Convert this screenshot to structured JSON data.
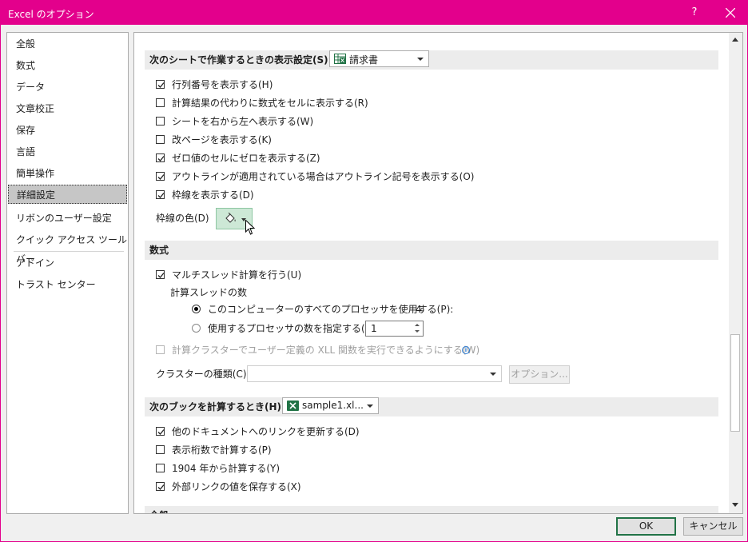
{
  "window": {
    "title": "Excel のオプション",
    "help_label": "?",
    "accent": "#e3008c"
  },
  "sidebar": {
    "items": [
      {
        "label": "全般"
      },
      {
        "label": "数式"
      },
      {
        "label": "データ"
      },
      {
        "label": "文章校正"
      },
      {
        "label": "保存"
      },
      {
        "label": "言語"
      },
      {
        "label": "簡単操作"
      },
      {
        "label": "詳細設定",
        "active": true
      },
      {
        "label": "リボンのユーザー設定"
      },
      {
        "label": "クイック アクセス ツール バー"
      },
      {
        "label": "アドイン"
      },
      {
        "label": "トラスト センター"
      }
    ]
  },
  "sheet_section": {
    "title": "次のシートで作業するときの表示設定(S):",
    "sheet_combo": "請求書",
    "options": [
      {
        "label": "行列番号を表示する(H)",
        "checked": true
      },
      {
        "label": "計算結果の代わりに数式をセルに表示する(R)",
        "checked": false
      },
      {
        "label": "シートを右から左へ表示する(W)",
        "checked": false
      },
      {
        "label": "改ページを表示する(K)",
        "checked": false
      },
      {
        "label": "ゼロ値のセルにゼロを表示する(Z)",
        "checked": true
      },
      {
        "label": "アウトラインが適用されている場合はアウトライン記号を表示する(O)",
        "checked": true
      },
      {
        "label": "枠線を表示する(D)",
        "checked": true
      }
    ],
    "gridline_color_label": "枠線の色(D)",
    "gridline_color_icon": "paint-bucket-icon"
  },
  "formula_section": {
    "title": "数式",
    "multithread_label": "マルチスレッド計算を行う(U)",
    "multithread_checked": true,
    "threads_label": "計算スレッドの数",
    "use_all_label": "このコンピューターのすべてのプロセッサを使用する(P):",
    "processor_count": "4",
    "use_all_selected": true,
    "manual_label": "使用するプロセッサの数を指定する(M):",
    "manual_value": "1",
    "cluster_label": "計算クラスターでユーザー定義の XLL 関数を実行できるようにする(W)",
    "cluster_type_label": "クラスターの種類(C):",
    "options_button": "オプション..."
  },
  "workbook_section": {
    "title": "次のブックを計算するとき(H):",
    "workbook_combo": "sample1.xl...",
    "options": [
      {
        "label": "他のドキュメントへのリンクを更新する(D)",
        "checked": true
      },
      {
        "label": "表示桁数で計算する(P)",
        "checked": false
      },
      {
        "label": "1904 年から計算する(Y)",
        "checked": false
      },
      {
        "label": "外部リンクの値を保存する(X)",
        "checked": true
      }
    ]
  },
  "next_section_title": "全般",
  "footer": {
    "ok": "OK",
    "cancel": "キャンセル"
  }
}
